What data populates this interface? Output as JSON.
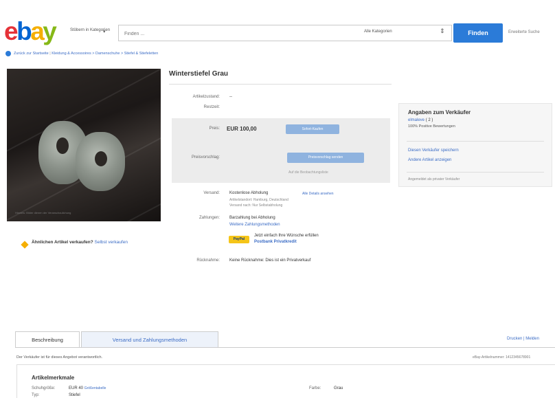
{
  "header": {
    "logo": {
      "e": "e",
      "b": "b",
      "a": "a",
      "y": "y"
    },
    "browse_label": "Stöbern in Kategorien",
    "search_placeholder": "Finden ...",
    "category_select": "Alle Kategorien",
    "find_button": "Finden",
    "advanced_search": "Erweiterte Suche"
  },
  "breadcrumb": {
    "back": "Zurück zur Startseite",
    "path": "Kleidung & Accessoires > Damenschuhe > Stiefel & Stiefeletten"
  },
  "product": {
    "title": "Winterstiefel Grau",
    "condition_label": "Artikelzustand:",
    "condition_value": "--",
    "remaining_label": "Restzeit:",
    "price_label": "Preis:",
    "price": "EUR 100,00",
    "buy_now_button": "Sofort-Kaufen",
    "watch_label": "Preisvorschlag:",
    "offer_button": "Preisvorschlag senden",
    "watchlist_note": "Auf die Beobachtungsliste",
    "shipping_label": "Versand:",
    "shipping_value": "Kostenlose Abholung",
    "shipping_details_link": "Alle Details ansehen",
    "item_location": "Artikelstandort: Hamburg, Deutschland",
    "ships_to": "Versand nach: Nur Selbstabholung",
    "payment_label": "Zahlungen:",
    "payment_value": "Barzahlung bei Abholung",
    "payment_more_link": "Weitere Zahlungsmethoden",
    "paypal_badge": "PayPal",
    "paypal_text": "Jetzt einfach Ihre Wünsche erfüllen",
    "paypal_link": "Postbank Privatkredit",
    "returns_label": "Rücknahme:",
    "returns_value": "Keine Rücknahme: Dies ist ein Privatverkauf",
    "image_caption": "Hinweis: Bilder dienen der Veranschaulichung"
  },
  "sell_cta": {
    "text": "Ähnlichen Artikel verkaufen?",
    "link": "Selbst verkaufen"
  },
  "seller": {
    "title": "Angaben zum Verkäufer",
    "name": "elmaleve",
    "rating": "( 2 )",
    "positive": "100% Positive Bewertungen",
    "save_link": "Diesen Verkäufer speichern",
    "other_items_link": "Andere Artikel anzeigen",
    "registered_note": "Angemeldet als privater Verkäufer"
  },
  "tabs": [
    {
      "label": "Beschreibung"
    },
    {
      "label": "Versand und Zahlungsmethoden"
    }
  ],
  "print_links": "Drucken | Melden",
  "responsibility": "Der Verkäufer ist für dieses Angebot verantwortlich.",
  "item_number": "eBay-Artikelnummer: 1412345678901",
  "attributes": {
    "title": "Artikelmerkmale",
    "size_label": "Schuhgröße:",
    "size_value": "EUR 40",
    "size_note": "Größentabelle",
    "type_label": "Typ:",
    "type_value": "Stiefel",
    "color_label": "Farbe:",
    "color_value": "Grau"
  }
}
